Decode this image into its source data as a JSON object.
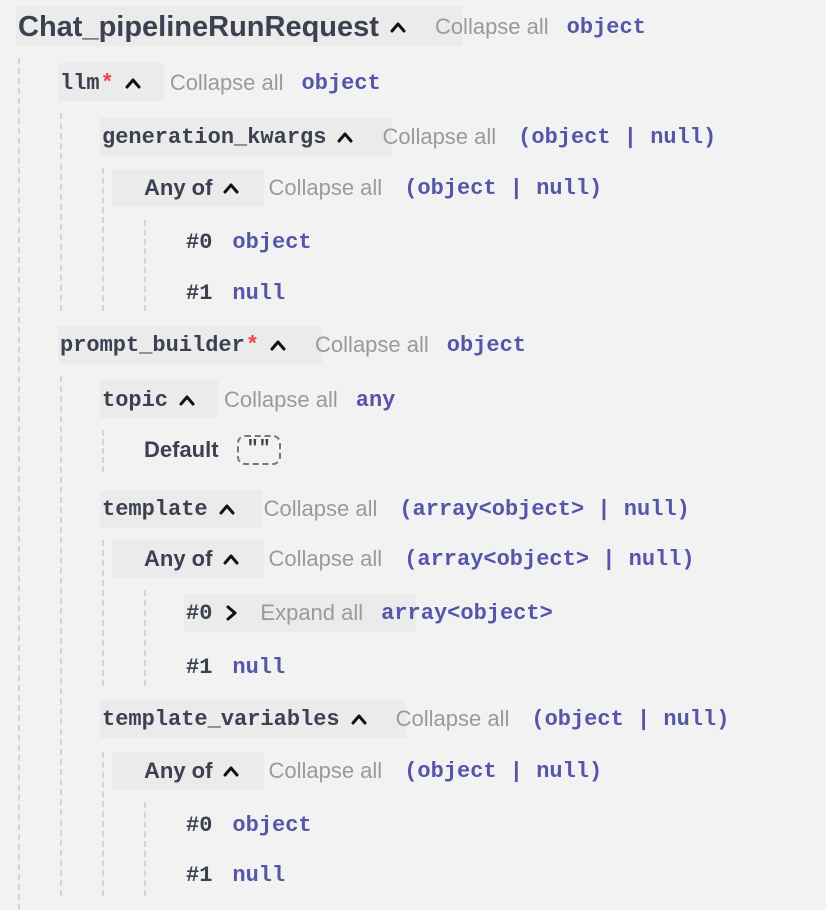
{
  "root": {
    "name": "Chat_pipelineRunRequest",
    "collapse": "Collapse all",
    "type": "object"
  },
  "llm": {
    "name": "llm",
    "required": "*",
    "collapse": "Collapse all",
    "type": "object"
  },
  "generation_kwargs": {
    "name": "generation_kwargs",
    "collapse": "Collapse all",
    "type": "(object | null)"
  },
  "gk_anyof": {
    "label": "Any of",
    "collapse": "Collapse all",
    "type": "(object | null)",
    "opt0_idx": "#0",
    "opt0_type": "object",
    "opt1_idx": "#1",
    "opt1_type": "null"
  },
  "prompt_builder": {
    "name": "prompt_builder",
    "required": "*",
    "collapse": "Collapse all",
    "type": "object"
  },
  "topic": {
    "name": "topic",
    "collapse": "Collapse all",
    "type": "any",
    "default_label": "Default",
    "default_value": "\"\""
  },
  "template": {
    "name": "template",
    "collapse": "Collapse all",
    "type": "(array<object> | null)"
  },
  "template_anyof": {
    "label": "Any of",
    "collapse": "Collapse all",
    "type": "(array<object> | null)",
    "opt0_idx": "#0",
    "opt0_expand": "Expand all",
    "opt0_type": "array<object>",
    "opt1_idx": "#1",
    "opt1_type": "null"
  },
  "template_variables": {
    "name": "template_variables",
    "collapse": "Collapse all",
    "type": "(object | null)"
  },
  "tv_anyof": {
    "label": "Any of",
    "collapse": "Collapse all",
    "type": "(object | null)",
    "opt0_idx": "#0",
    "opt0_type": "object",
    "opt1_idx": "#1",
    "opt1_type": "null"
  }
}
